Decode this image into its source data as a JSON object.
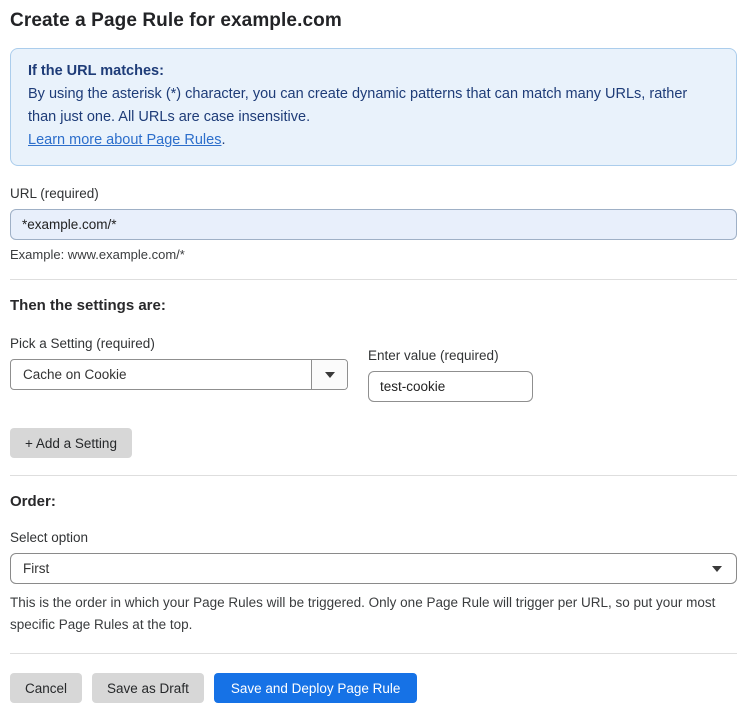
{
  "page": {
    "title": "Create a Page Rule for example.com"
  },
  "info_box": {
    "heading": "If the URL matches:",
    "body": "By using the asterisk (*) character, you can create dynamic patterns that can match many URLs, rather than just one. All URLs are case insensitive.",
    "link_label": "Learn more about Page Rules",
    "link_suffix": "."
  },
  "url_field": {
    "label": "URL (required)",
    "value": "*example.com/*",
    "helper": "Example: www.example.com/*"
  },
  "settings_section": {
    "heading": "Then the settings are:",
    "setting_label": "Pick a Setting (required)",
    "setting_value": "Cache on Cookie",
    "value_label": "Enter value (required)",
    "value_value": "test-cookie",
    "add_button_label": "+ Add a Setting"
  },
  "order_section": {
    "heading": "Order:",
    "select_label": "Select option",
    "select_value": "First",
    "helper": "This is the order in which your Page Rules will be triggered. Only one Page Rule will trigger per URL, so put your most specific Page Rules at the top."
  },
  "actions": {
    "cancel_label": "Cancel",
    "save_draft_label": "Save as Draft",
    "save_deploy_label": "Save and Deploy Page Rule"
  },
  "icons": {
    "dropdown_arrow": "chevron-down"
  },
  "colors": {
    "accent_blue": "#1672e6",
    "info_background": "#e9f2fb",
    "info_border": "#abcdec",
    "info_text": "#1e3c78",
    "link_blue": "#2c6ecb",
    "url_input_background": "#e8effb",
    "gray_button": "#d7d7d7"
  }
}
